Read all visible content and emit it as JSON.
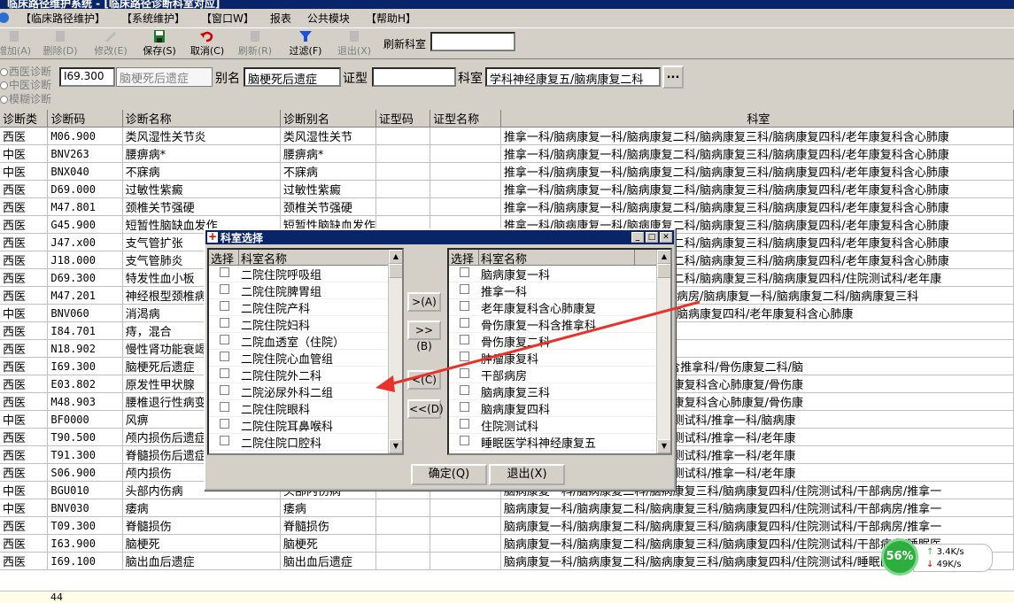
{
  "window": {
    "title": "临床路径维护系统 - [临床路径诊断科室对应]"
  },
  "menu": [
    "【临床路径维护】",
    "【系统维护】",
    "【窗口W】",
    "报表",
    "公共模块",
    "【帮助H】"
  ],
  "toolbar": {
    "buttons": [
      {
        "label": "增加(A)",
        "icon": "add-icon",
        "enabled": false
      },
      {
        "label": "删除(D)",
        "icon": "delete-icon",
        "enabled": false
      },
      {
        "label": "修改(E)",
        "icon": "edit-icon",
        "enabled": false
      },
      {
        "label": "保存(S)",
        "icon": "save-icon",
        "enabled": true
      },
      {
        "label": "取消(C)",
        "icon": "undo-icon",
        "enabled": true
      },
      {
        "label": "刷新(R)",
        "icon": "refresh-icon",
        "enabled": false
      },
      {
        "label": "过滤(F)",
        "icon": "filter-icon",
        "enabled": true
      },
      {
        "label": "退出(X)",
        "icon": "exit-icon",
        "enabled": false
      }
    ],
    "refresh_dept_label": "刷新科室",
    "refresh_dept_value": ""
  },
  "filter": {
    "radios": [
      "西医诊断",
      "中医诊断",
      "模糊诊断"
    ],
    "code": "I69.300",
    "diag_name": "脑梗死后遗症",
    "alias_label": "别名",
    "alias": "脑梗死后遗症",
    "syndrome_label": "证型",
    "syndrome": "",
    "dept_label": "科室",
    "dept": "学科神经康复五/脑病康复二科",
    "browse_button": "..."
  },
  "grid": {
    "columns": [
      "诊断类",
      "诊断码",
      "诊断名称",
      "诊断别名",
      "证型码",
      "证型名称",
      "科室"
    ],
    "rows": [
      [
        "西医",
        "M06.900",
        "类风湿性关节炎",
        "类风湿性关节",
        "",
        "",
        "推拿一科/脑病康复一科/脑病康复二科/脑病康复三科/脑病康复四科/老年康复科含心肺康"
      ],
      [
        "中医",
        "BNV263",
        "腰痹病*",
        "腰痹病*",
        "",
        "",
        "推拿一科/脑病康复一科/脑病康复二科/脑病康复三科/脑病康复四科/老年康复科含心肺康"
      ],
      [
        "中医",
        "BNX040",
        "不寐病",
        "不寐病",
        "",
        "",
        "推拿一科/脑病康复一科/脑病康复二科/脑病康复三科/脑病康复四科/老年康复科含心肺康"
      ],
      [
        "西医",
        "D69.000",
        "过敏性紫癜",
        "过敏性紫癜",
        "",
        "",
        "推拿一科/脑病康复一科/脑病康复二科/脑病康复三科/脑病康复四科/老年康复科含心肺康"
      ],
      [
        "西医",
        "M47.801",
        "颈椎关节强硬",
        "颈椎关节强硬",
        "",
        "",
        "推拿一科/脑病康复一科/脑病康复二科/脑病康复三科/脑病康复四科/老年康复科含心肺康"
      ],
      [
        "西医",
        "G45.900",
        "短暂性脑缺血发作",
        "短暂性脑缺血发作",
        "",
        "",
        "推拿一科/脑病康复一科/脑病康复二科/脑病康复三科/脑病康复四科/老年康复科含心肺康"
      ],
      [
        "西医",
        "J47.x00",
        "支气管扩张",
        "支气管扩张",
        "",
        "",
        "推拿一科/脑病康复一科/脑病康复二科/脑病康复三科/脑病康复四科/老年康复科含心肺康"
      ],
      [
        "西医",
        "J18.000",
        "支气管肺炎",
        "支气管肺炎",
        "",
        "",
        "推拿一科/脑病康复一科/脑病康复二科/脑病康复三科/脑病康复四科/老年康复科含心肺康"
      ],
      [
        "西医",
        "D69.300",
        "特发性血小板",
        "特发性血小板",
        "",
        "",
        "推拿一科/脑病康复一科/脑病康复二科/脑病康复三科/脑病康复四科/住院测试科/老年康"
      ],
      [
        "西医",
        "M47.201",
        "神经根型颈椎病",
        "神经根型颈椎病",
        "",
        "",
        "科/骨伤康复二科/住院测试科/干部病房/脑病康复一科/脑病康复二科/脑病康复三科"
      ],
      [
        "中医",
        "BNV060",
        "消渴病",
        "消渴病",
        "",
        "",
        "一科/脑病康复二科/脑病康复三科/脑病康复四科/老年康复科含心肺康"
      ],
      [
        "西医",
        "I84.701",
        "痔，混合",
        "痔，混合",
        "",
        "",
        ""
      ],
      [
        "西医",
        "N18.902",
        "慢性肾功能衰竭",
        "慢性肾功能衰竭",
        "",
        "",
        ""
      ],
      [
        "西医",
        "I69.300",
        "脑梗死后遗症",
        "脑梗死后遗症",
        "",
        "",
        "康复科含心肺康复/骨伤康复一科含推拿科/骨伤康复二科/脑"
      ],
      [
        "西医",
        "E03.802",
        "原发性甲状腺",
        "原发性甲状腺",
        "",
        "",
        "脑病康复三科/脑病康复四科/老年康复科含心肺康复/骨伤康"
      ],
      [
        "西医",
        "M48.903",
        "腰椎退行性病变",
        "腰椎退行性病变",
        "",
        "",
        "脑病康复三科/脑病康复四科/老年康复科含心肺康复/骨伤康"
      ],
      [
        "中医",
        "BF0000",
        "风痹",
        "风痹",
        "",
        "",
        "脑病康复三科/脑病康复四科/住院测试科/推拿一科/脑病康"
      ],
      [
        "西医",
        "T90.500",
        "颅内损伤后遗症",
        "颅内损伤后遗症",
        "",
        "",
        "脑病康复三科/脑病康复四科/住院测试科/推拿一科/老年康"
      ],
      [
        "西医",
        "T91.300",
        "脊髓损伤后遗症",
        "脊髓损伤后遗症",
        "",
        "",
        "脑病康复三科/脑病康复四科/住院测试科/推拿一科/老年康"
      ],
      [
        "西医",
        "S06.900",
        "颅内损伤",
        "颅内损伤",
        "",
        "",
        "脑病康复三科/脑病康复四科/住院测试科/推拿一科/老年康"
      ],
      [
        "中医",
        "BGU010",
        "头部内伤病",
        "头部内伤病",
        "",
        "",
        "脑病康复一科/脑病康复二科/脑病康复三科/脑病康复四科/住院测试科/干部病房/推拿一"
      ],
      [
        "中医",
        "BNV030",
        "痿病",
        "痿病",
        "",
        "",
        "脑病康复一科/脑病康复二科/脑病康复三科/脑病康复四科/住院测试科/干部病房/推拿一"
      ],
      [
        "西医",
        "T09.300",
        "脊髓损伤",
        "脊髓损伤",
        "",
        "",
        "脑病康复一科/脑病康复二科/脑病康复三科/脑病康复四科/住院测试科/干部病房/推拿一"
      ],
      [
        "西医",
        "I63.900",
        "脑梗死",
        "脑梗死",
        "",
        "",
        "脑病康复一科/脑病康复二科/脑病康复三科/脑病康复四科/住院测试科/干部病房/睡眠医"
      ],
      [
        "西医",
        "I69.100",
        "脑出血后遗症",
        "脑出血后遗症",
        "",
        "",
        "脑病康复一科/脑病康复二科/脑病康复三科/脑病康复四科/住院测试科/睡眠医学科神经康"
      ]
    ],
    "footer_count": "44"
  },
  "dialog": {
    "title": "科室选择",
    "left_header": [
      "选择",
      "科室名称"
    ],
    "left_items": [
      "二院住院呼吸组",
      "二院住院脾胃组",
      "二院住院产科",
      "二院住院妇科",
      "二院血透室（住院）",
      "二院住院心血管组",
      "二院住院外二科",
      "二院泌尿外科二组",
      "二院住院眼科",
      "二院住院耳鼻喉科",
      "二院住院口腔科"
    ],
    "right_header": [
      "选择",
      "科室名称"
    ],
    "right_items": [
      "脑病康复一科",
      "推拿一科",
      "老年康复科含心肺康复",
      "骨伤康复一科含推拿科",
      "骨伤康复二科",
      "肿瘤康复科",
      "干部病房",
      "脑病康复三科",
      "脑病康复四科",
      "住院测试科",
      "睡眠医学科神经康复五"
    ],
    "move_buttons": [
      ">(A)",
      ">>(B)",
      "<(C)",
      "<<(D)"
    ],
    "ok_button": "确定(Q)",
    "exit_button": "退出(X)"
  },
  "net_widget": {
    "percent": "56%",
    "up": "3.4K/s",
    "down": "49K/s"
  },
  "colors": {
    "titlebar": "#0a246a",
    "arrow": "#e8322a",
    "net_ball": "#2eae3f"
  }
}
